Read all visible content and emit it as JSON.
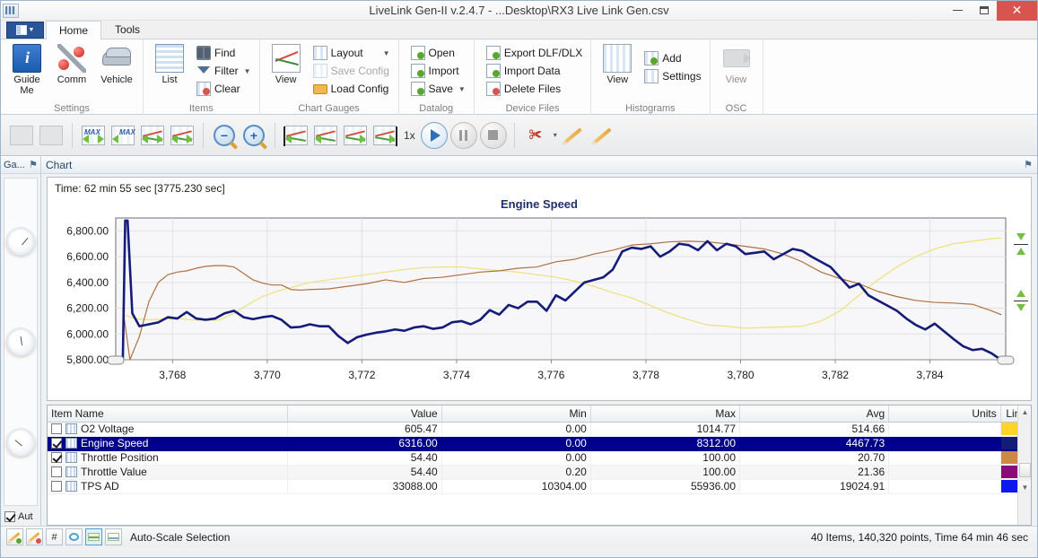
{
  "window": {
    "title": "LiveLink Gen-II  v.2.4.7 - ...Desktop\\RX3 Live Link Gen.csv",
    "minimize_label": "—",
    "maximize_label": "❐",
    "close_label": "✕"
  },
  "ribbon": {
    "app_button": "app-menu",
    "tabs": [
      {
        "label": "Home",
        "active": true
      },
      {
        "label": "Tools",
        "active": false
      }
    ],
    "groups": [
      {
        "name": "Settings",
        "label": "Settings",
        "big_buttons": [
          {
            "label": "Guide\nMe",
            "label_line1": "Guide",
            "label_line2": "Me",
            "icon": "guide-me-icon"
          },
          {
            "label": "Comm",
            "icon": "comm-icon"
          },
          {
            "label": "Vehicle",
            "icon": "vehicle-icon"
          }
        ]
      },
      {
        "name": "Items",
        "label": "Items",
        "big_buttons": [
          {
            "label": "List",
            "icon": "list-icon"
          }
        ],
        "small_buttons": [
          {
            "label": "Find",
            "icon": "binoculars-icon",
            "disabled": false,
            "dropdown": false
          },
          {
            "label": "Filter",
            "icon": "funnel-icon",
            "disabled": false,
            "dropdown": true
          },
          {
            "label": "Clear",
            "icon": "clear-icon",
            "disabled": false,
            "dropdown": false
          }
        ]
      },
      {
        "name": "ChartGauges",
        "label": "Chart  Gauges",
        "big_buttons": [
          {
            "label": "View",
            "icon": "chart-view-icon"
          }
        ],
        "small_buttons": [
          {
            "label": "Layout",
            "icon": "layout-icon",
            "disabled": false,
            "dropdown": true
          },
          {
            "label": "Save Config",
            "icon": "save-config-icon",
            "disabled": true,
            "dropdown": false
          },
          {
            "label": "Load Config",
            "icon": "load-config-icon",
            "disabled": false,
            "dropdown": false
          }
        ]
      },
      {
        "name": "Datalog",
        "label": "Datalog",
        "small_buttons": [
          {
            "label": "Open",
            "icon": "open-icon",
            "disabled": false,
            "dropdown": false
          },
          {
            "label": "Import",
            "icon": "import-icon",
            "disabled": false,
            "dropdown": false
          },
          {
            "label": "Save",
            "icon": "save-icon",
            "disabled": false,
            "dropdown": true
          }
        ]
      },
      {
        "name": "DeviceFiles",
        "label": "Device Files",
        "small_buttons": [
          {
            "label": "Export DLF/DLX",
            "icon": "export-icon",
            "disabled": false,
            "dropdown": false
          },
          {
            "label": "Import Data",
            "icon": "import-data-icon",
            "disabled": false,
            "dropdown": false
          },
          {
            "label": "Delete Files",
            "icon": "delete-files-icon",
            "disabled": false,
            "dropdown": false
          }
        ]
      },
      {
        "name": "Histograms",
        "label": "Histograms",
        "big_buttons": [
          {
            "label": "View",
            "icon": "histogram-view-icon"
          }
        ],
        "small_buttons": [
          {
            "label": "Add",
            "icon": "add-icon",
            "disabled": false,
            "dropdown": false
          },
          {
            "label": "Settings",
            "icon": "settings-icon",
            "disabled": false,
            "dropdown": false
          }
        ]
      },
      {
        "name": "OSC",
        "label": "OSC",
        "big_buttons": [
          {
            "label": "View",
            "icon": "osc-view-icon",
            "disabled": true
          }
        ]
      }
    ]
  },
  "toolbar": {
    "playback_rate": "1x",
    "buttons": [
      {
        "name": "device-left-button",
        "disabled": true
      },
      {
        "name": "device-right-button",
        "disabled": true
      },
      {
        "name": "max-scroll-horizontal-button",
        "disabled": false
      },
      {
        "name": "max-scroll-vertical-button",
        "disabled": false
      },
      {
        "name": "scroll-chart-left-right-button",
        "disabled": false
      },
      {
        "name": "scroll-chart-page-button",
        "disabled": false
      },
      {
        "name": "zoom-out-button",
        "disabled": false
      },
      {
        "name": "zoom-in-button",
        "disabled": false
      },
      {
        "name": "goto-start-button",
        "disabled": false
      },
      {
        "name": "step-back-button",
        "disabled": false
      },
      {
        "name": "step-forward-button",
        "disabled": false
      },
      {
        "name": "goto-end-button",
        "disabled": false
      },
      {
        "name": "play-button",
        "disabled": false
      },
      {
        "name": "pause-button",
        "disabled": true
      },
      {
        "name": "stop-button",
        "disabled": true
      },
      {
        "name": "cut-marker-button",
        "disabled": false
      },
      {
        "name": "marker-back-button",
        "disabled": false
      },
      {
        "name": "marker-forward-button",
        "disabled": false
      }
    ]
  },
  "gauges_panel": {
    "title": "Ga...",
    "pin_label": "⚑",
    "auto_label": "Aut",
    "auto_checked": true,
    "gauges": [
      "gauge-1",
      "gauge-2",
      "gauge-3"
    ]
  },
  "chart_panel": {
    "title": "Chart",
    "pin_label": "⚑",
    "time_label": "Time: 62 min 55 sec [3775.230 sec]"
  },
  "chart_data": {
    "type": "line",
    "title": "Engine Speed",
    "xlabel": "",
    "ylabel": "",
    "xlim": [
      3766.8,
      3785.6
    ],
    "ylim": [
      5800,
      6900
    ],
    "grid": true,
    "legend": "none",
    "y_ticks": [
      "6,800.00",
      "6,600.00",
      "6,400.00",
      "6,200.00",
      "6,000.00",
      "5,800.00"
    ],
    "y_tick_values": [
      6800,
      6600,
      6400,
      6200,
      6000,
      5800
    ],
    "x_ticks": [
      "3,768",
      "3,770",
      "3,772",
      "3,774",
      "3,776",
      "3,778",
      "3,780",
      "3,782",
      "3,784"
    ],
    "x_tick_values": [
      3768,
      3770,
      3772,
      3774,
      3776,
      3778,
      3780,
      3782,
      3784
    ],
    "series": [
      {
        "name": "Engine Speed",
        "color": "#151b78",
        "width": 2.6,
        "x": [
          3766.95,
          3767.0,
          3767.05,
          3767.15,
          3767.3,
          3767.5,
          3767.7,
          3767.9,
          3768.1,
          3768.3,
          3768.5,
          3768.7,
          3768.9,
          3769.1,
          3769.3,
          3769.5,
          3769.7,
          3769.9,
          3770.1,
          3770.3,
          3770.5,
          3770.7,
          3770.9,
          3771.1,
          3771.3,
          3771.5,
          3771.7,
          3771.9,
          3772.1,
          3772.3,
          3772.5,
          3772.7,
          3772.9,
          3773.1,
          3773.3,
          3773.5,
          3773.7,
          3773.9,
          3774.1,
          3774.3,
          3774.5,
          3774.7,
          3774.9,
          3775.1,
          3775.3,
          3775.5,
          3775.7,
          3775.9,
          3776.1,
          3776.3,
          3776.5,
          3776.7,
          3776.9,
          3777.1,
          3777.3,
          3777.5,
          3777.7,
          3777.9,
          3778.1,
          3778.3,
          3778.5,
          3778.7,
          3778.9,
          3779.1,
          3779.3,
          3779.5,
          3779.7,
          3779.9,
          3780.1,
          3780.3,
          3780.5,
          3780.7,
          3780.9,
          3781.1,
          3781.3,
          3781.5,
          3781.7,
          3781.9,
          3782.1,
          3782.3,
          3782.5,
          3782.7,
          3782.9,
          3783.1,
          3783.3,
          3783.5,
          3783.7,
          3783.9,
          3784.1,
          3784.3,
          3784.5,
          3784.7,
          3784.9,
          3785.1,
          3785.3,
          3785.5
        ],
        "y": [
          5800,
          6880,
          6880,
          6160,
          6060,
          6075,
          6090,
          6130,
          6120,
          6170,
          6120,
          6110,
          6120,
          6160,
          6180,
          6130,
          6115,
          6130,
          6140,
          6110,
          6050,
          6055,
          6075,
          6060,
          6060,
          5985,
          5930,
          5975,
          5995,
          6010,
          6020,
          6035,
          6025,
          6050,
          6060,
          6040,
          6050,
          6090,
          6100,
          6075,
          6110,
          6185,
          6150,
          6225,
          6200,
          6250,
          6250,
          6180,
          6300,
          6260,
          6330,
          6400,
          6420,
          6440,
          6500,
          6640,
          6670,
          6660,
          6680,
          6600,
          6640,
          6700,
          6690,
          6650,
          6720,
          6650,
          6700,
          6680,
          6620,
          6630,
          6640,
          6580,
          6620,
          6660,
          6645,
          6600,
          6560,
          6520,
          6440,
          6360,
          6390,
          6300,
          6260,
          6220,
          6180,
          6120,
          6070,
          6035,
          6080,
          6020,
          5960,
          5905,
          5875,
          5885,
          5850,
          5800
        ]
      },
      {
        "name": "Throttle Position",
        "color": "#b07040",
        "width": 1.2,
        "x": [
          3766.95,
          3767.1,
          3767.3,
          3767.5,
          3767.7,
          3767.9,
          3768.1,
          3768.3,
          3768.5,
          3768.7,
          3768.9,
          3769.1,
          3769.3,
          3769.5,
          3769.7,
          3769.9,
          3770.1,
          3770.3,
          3770.5,
          3770.7,
          3770.9,
          3771.3,
          3771.7,
          3772.1,
          3772.5,
          3772.9,
          3773.3,
          3773.7,
          3774.1,
          3774.5,
          3774.9,
          3775.3,
          3775.7,
          3776.1,
          3776.5,
          3776.9,
          3777.3,
          3777.7,
          3778.1,
          3778.5,
          3778.9,
          3779.3,
          3779.7,
          3780.1,
          3780.5,
          3780.9,
          3781.3,
          3781.7,
          3782.1,
          3782.5,
          3782.9,
          3783.3,
          3783.7,
          3784.1,
          3784.5,
          3784.9,
          3785.3,
          3785.5
        ],
        "y": [
          6200,
          5790,
          5980,
          6250,
          6400,
          6460,
          6480,
          6490,
          6510,
          6525,
          6530,
          6530,
          6520,
          6470,
          6420,
          6395,
          6380,
          6380,
          6345,
          6340,
          6345,
          6350,
          6370,
          6390,
          6420,
          6400,
          6430,
          6440,
          6460,
          6480,
          6490,
          6510,
          6520,
          6560,
          6580,
          6620,
          6650,
          6690,
          6700,
          6715,
          6720,
          6715,
          6700,
          6680,
          6660,
          6620,
          6560,
          6480,
          6430,
          6390,
          6330,
          6290,
          6260,
          6245,
          6240,
          6230,
          6180,
          6150
        ]
      },
      {
        "name": "O2 Voltage",
        "color": "#eee07a",
        "width": 1.2,
        "x": [
          3766.95,
          3767.2,
          3767.5,
          3767.8,
          3768.1,
          3768.4,
          3768.7,
          3769.0,
          3769.3,
          3769.6,
          3769.9,
          3770.2,
          3770.5,
          3770.9,
          3771.3,
          3771.7,
          3772.1,
          3772.5,
          3772.9,
          3773.3,
          3773.7,
          3774.1,
          3774.5,
          3774.9,
          3775.3,
          3775.7,
          3776.1,
          3776.5,
          3776.9,
          3777.3,
          3777.7,
          3778.1,
          3778.5,
          3778.9,
          3779.3,
          3779.7,
          3780.1,
          3780.5,
          3780.9,
          3781.3,
          3781.7,
          3782.1,
          3782.5,
          3782.9,
          3783.3,
          3783.7,
          3784.1,
          3784.5,
          3784.9,
          3785.3,
          3785.5
        ],
        "y": [
          6150,
          6120,
          6110,
          6115,
          6120,
          6110,
          6105,
          6110,
          6160,
          6230,
          6290,
          6330,
          6360,
          6400,
          6420,
          6440,
          6460,
          6480,
          6500,
          6515,
          6520,
          6520,
          6505,
          6490,
          6480,
          6460,
          6440,
          6410,
          6370,
          6320,
          6280,
          6220,
          6160,
          6110,
          6070,
          6060,
          6045,
          6050,
          6055,
          6060,
          6100,
          6180,
          6300,
          6420,
          6520,
          6600,
          6660,
          6700,
          6720,
          6740,
          6745
        ]
      }
    ]
  },
  "table": {
    "columns": [
      {
        "key": "name",
        "label": "Item Name",
        "align": "left"
      },
      {
        "key": "value",
        "label": "Value",
        "align": "right"
      },
      {
        "key": "min",
        "label": "Min",
        "align": "right"
      },
      {
        "key": "max",
        "label": "Max",
        "align": "right"
      },
      {
        "key": "avg",
        "label": "Avg",
        "align": "right"
      },
      {
        "key": "units",
        "label": "Units",
        "align": "right"
      },
      {
        "key": "line",
        "label": "Line",
        "align": "right"
      }
    ],
    "rows": [
      {
        "checked": false,
        "name": "O2 Voltage",
        "value": "605.47",
        "min": "0.00",
        "max": "1014.77",
        "avg": "514.66",
        "units": "",
        "color": "#ffd42a",
        "selected": false
      },
      {
        "checked": true,
        "name": "Engine Speed",
        "value": "6316.00",
        "min": "0.00",
        "max": "8312.00",
        "avg": "4467.73",
        "units": "",
        "color": "#151b78",
        "selected": true
      },
      {
        "checked": true,
        "name": "Throttle Position",
        "value": "54.40",
        "min": "0.00",
        "max": "100.00",
        "avg": "20.70",
        "units": "",
        "color": "#cc8844",
        "selected": false
      },
      {
        "checked": false,
        "name": "Throttle Value",
        "value": "54.40",
        "min": "0.20",
        "max": "100.00",
        "avg": "21.36",
        "units": "",
        "color": "#8b0a7a",
        "selected": false
      },
      {
        "checked": false,
        "name": "TPS AD",
        "value": "33088.00",
        "min": "10304.00",
        "max": "55936.00",
        "avg": "19024.91",
        "units": "",
        "color": "#0d18ef",
        "selected": false
      }
    ]
  },
  "statusbar": {
    "label": "Auto-Scale Selection",
    "summary": "40 Items, 140,320 points, Time 64 min 46 sec",
    "buttons": [
      {
        "name": "marker-green-button",
        "active": false
      },
      {
        "name": "marker-red-button",
        "active": false
      },
      {
        "name": "hash-button",
        "active": false,
        "glyph": "#"
      },
      {
        "name": "cycle-button",
        "active": false
      },
      {
        "name": "auto-scale-button",
        "active": true
      },
      {
        "name": "auto-scale-selection-button",
        "active": false
      }
    ]
  }
}
